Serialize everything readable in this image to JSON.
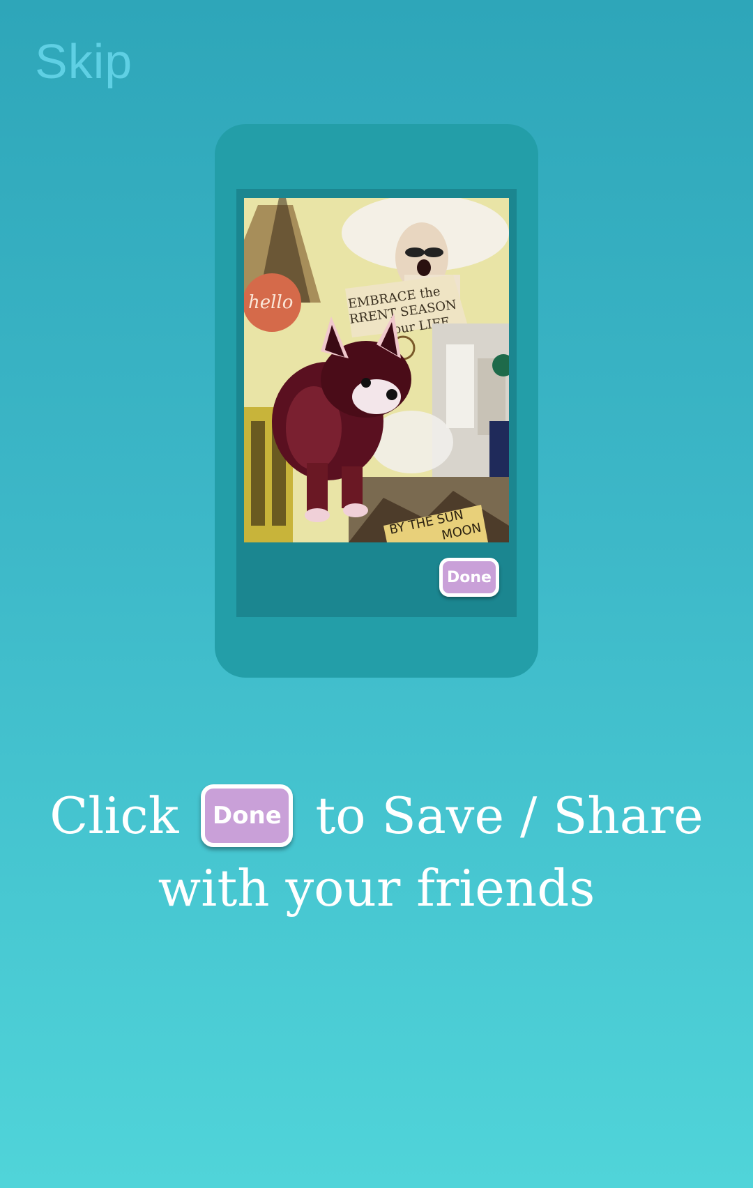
{
  "header": {
    "skip_label": "Skip"
  },
  "phone": {
    "collage": {
      "hello_text": "hello",
      "banner_lines": [
        "EMBRACE the",
        "RRENT SEASON",
        "your LIFE."
      ],
      "sign_lines": [
        "BY THE SUN",
        "MOON"
      ]
    },
    "done_label": "Done"
  },
  "instruction": {
    "before": "Click",
    "done_label": "Done",
    "after": "to Save / Share",
    "line2": "with your friends"
  },
  "colors": {
    "done_button": "#c9a0d8",
    "phone_body": "#239ea8",
    "text": "#ffffff"
  }
}
